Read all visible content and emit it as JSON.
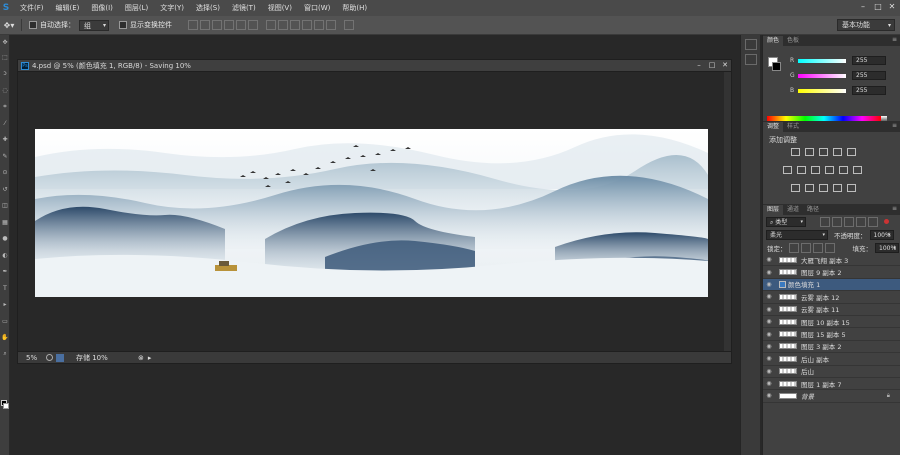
{
  "app": {
    "logo": "S"
  },
  "menu": [
    "文件(F)",
    "编辑(E)",
    "图像(I)",
    "图层(L)",
    "文字(Y)",
    "选择(S)",
    "滤镜(T)",
    "视图(V)",
    "窗口(W)",
    "帮助(H)"
  ],
  "options_bar": {
    "auto_select_label": "自动选择：",
    "auto_select_value": "组",
    "show_transform_label": "显示变换控件",
    "workspace": "基本功能"
  },
  "document": {
    "title": "4.psd @ 5% (颜色填充 1, RGB/8) - Saving 10%",
    "zoom": "5%",
    "status": "存储 10%"
  },
  "panels": {
    "color_tab": "颜色",
    "swatches_tab": "色板",
    "r_label": "R",
    "g_label": "G",
    "b_label": "B",
    "r_value": "255",
    "g_value": "255",
    "b_value": "255",
    "adjust_tab": "调整",
    "styles_tab": "样式",
    "adjust_title": "添加调整",
    "layers_tab": "图层",
    "channels_tab": "通道",
    "paths_tab": "路径",
    "filter_kind": "类型",
    "blend_mode": "柔光",
    "opacity_label": "不透明度：",
    "opacity_value": "100%",
    "lock_label": "锁定：",
    "fill_label": "填充：",
    "fill_value": "100%"
  },
  "layers": [
    {
      "name": "大雁飞翔 副本 3",
      "type": "normal"
    },
    {
      "name": "图层 9 副本 2",
      "type": "normal"
    },
    {
      "name": "颜色填充 1",
      "type": "fill",
      "selected": true
    },
    {
      "name": "云雾 副本 12",
      "type": "normal"
    },
    {
      "name": "云雾 副本 11",
      "type": "normal"
    },
    {
      "name": "图层 10 副本 15",
      "type": "normal"
    },
    {
      "name": "图层 15 副本 5",
      "type": "normal"
    },
    {
      "name": "图层 3 副本 2",
      "type": "normal"
    },
    {
      "name": "后山 副本",
      "type": "normal"
    },
    {
      "name": "后山",
      "type": "normal"
    },
    {
      "name": "图层 1 副本 7",
      "type": "normal"
    },
    {
      "name": "背景",
      "type": "background"
    }
  ],
  "colors": {
    "accent": "#2d8bd6",
    "selected_layer": "#3d5a7e"
  }
}
